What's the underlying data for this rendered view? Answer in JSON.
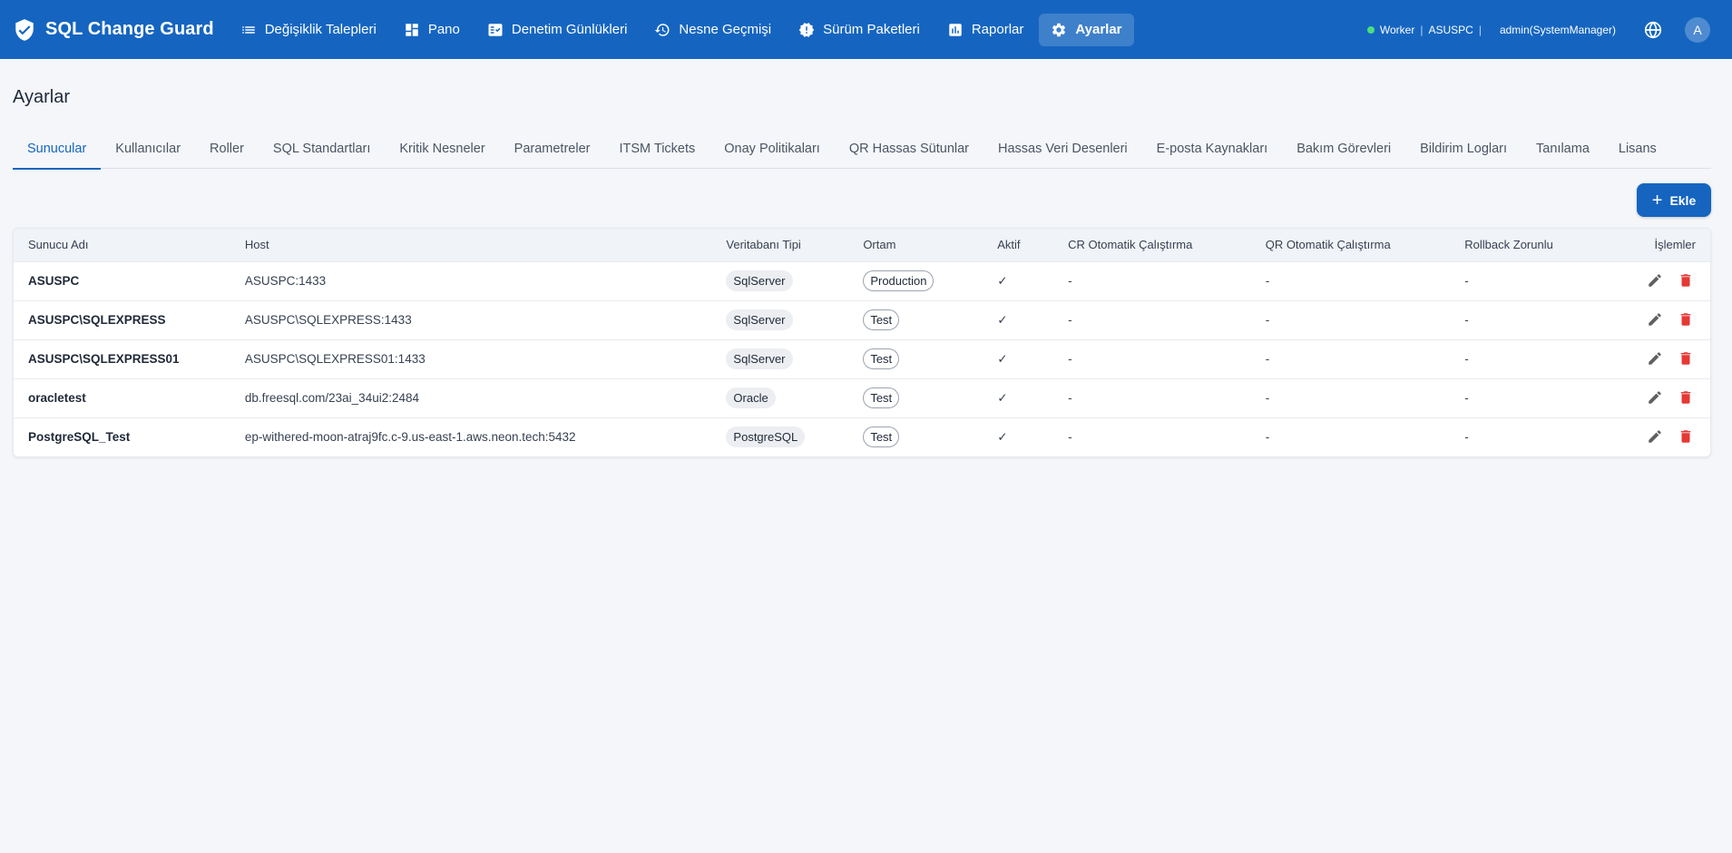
{
  "app": {
    "title": "SQL Change Guard"
  },
  "nav": [
    {
      "label": "Değişiklik Talepleri",
      "icon": "list-icon"
    },
    {
      "label": "Pano",
      "icon": "dashboard-icon"
    },
    {
      "label": "Denetim Günlükleri",
      "icon": "fact-check-icon"
    },
    {
      "label": "Nesne Geçmişi",
      "icon": "history-icon"
    },
    {
      "label": "Sürüm Paketleri",
      "icon": "badge-icon"
    },
    {
      "label": "Raporlar",
      "icon": "bar-chart-icon"
    },
    {
      "label": "Ayarlar",
      "icon": "gear-icon",
      "active": true
    }
  ],
  "status": {
    "worker": "Worker",
    "host": "ASUSPC",
    "user": "admin(SystemManager)",
    "dot_color": "#4ade80"
  },
  "avatar": {
    "initial": "A"
  },
  "page": {
    "title": "Ayarlar"
  },
  "tabs": [
    "Sunucular",
    "Kullanıcılar",
    "Roller",
    "SQL Standartları",
    "Kritik Nesneler",
    "Parametreler",
    "ITSM Tickets",
    "Onay Politikaları",
    "QR Hassas Sütunlar",
    "Hassas Veri Desenleri",
    "E-posta Kaynakları",
    "Bakım Görevleri",
    "Bildirim Logları",
    "Tanılama",
    "Lisans"
  ],
  "active_tab": 0,
  "add_button": {
    "label": "Ekle"
  },
  "table": {
    "columns": [
      "Sunucu Adı",
      "Host",
      "Veritabanı Tipi",
      "Ortam",
      "Aktif",
      "CR Otomatik Çalıştırma",
      "QR Otomatik Çalıştırma",
      "Rollback Zorunlu",
      "İşlemler"
    ],
    "rows": [
      {
        "name": "ASUSPC",
        "host": "ASUSPC:1433",
        "db_type": "SqlServer",
        "env": "Production",
        "active": "✓",
        "cr": "-",
        "qr": "-",
        "rollback": "-"
      },
      {
        "name": "ASUSPC\\SQLEXPRESS",
        "host": "ASUSPC\\SQLEXPRESS:1433",
        "db_type": "SqlServer",
        "env": "Test",
        "active": "✓",
        "cr": "-",
        "qr": "-",
        "rollback": "-"
      },
      {
        "name": "ASUSPC\\SQLEXPRESS01",
        "host": "ASUSPC\\SQLEXPRESS01:1433",
        "db_type": "SqlServer",
        "env": "Test",
        "active": "✓",
        "cr": "-",
        "qr": "-",
        "rollback": "-"
      },
      {
        "name": "oracletest",
        "host": "db.freesql.com/23ai_34ui2:2484",
        "db_type": "Oracle",
        "env": "Test",
        "active": "✓",
        "cr": "-",
        "qr": "-",
        "rollback": "-"
      },
      {
        "name": "PostgreSQL_Test",
        "host": "ep-withered-moon-atraj9fc.c-9.us-east-1.aws.neon.tech:5432",
        "db_type": "PostgreSQL",
        "env": "Test",
        "active": "✓",
        "cr": "-",
        "qr": "-",
        "rollback": "-"
      }
    ]
  },
  "colors": {
    "primary": "#1565c0",
    "danger": "#e53935",
    "edit": "#616161"
  }
}
